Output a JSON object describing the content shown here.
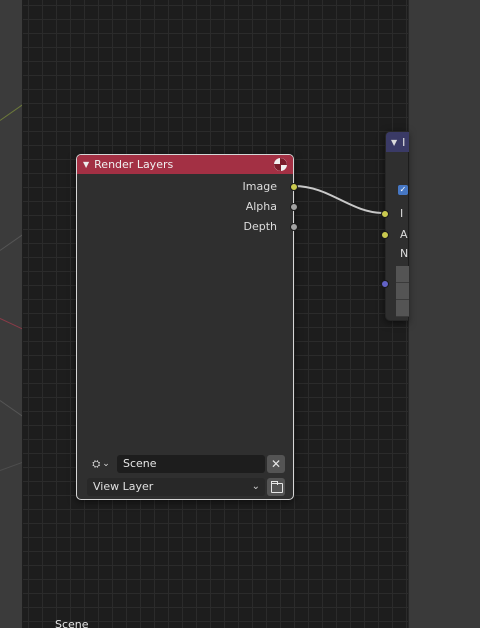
{
  "node_render_layers": {
    "title": "Render Layers",
    "outputs": [
      {
        "label": "Image",
        "socket_color": "#c9c94f"
      },
      {
        "label": "Alpha",
        "socket_color": "#a1a1a1"
      },
      {
        "label": "Depth",
        "socket_color": "#a1a1a1"
      }
    ],
    "scene_field": "Scene",
    "layer_select": "View Layer",
    "header_color": "#a33044"
  },
  "node_partial": {
    "title": "I",
    "inputs": [
      {
        "label": "I",
        "socket_color": "#c9c94f"
      },
      {
        "label": "A",
        "socket_color": "#c9c94f"
      },
      {
        "label": "N"
      },
      {
        "label": "",
        "socket_color": "#6363c7"
      }
    ],
    "header_color": "#3a3a66"
  },
  "footer": {
    "scene_label": "Scene"
  },
  "icons": {
    "collapse": "▼",
    "close": "✕",
    "chevron": "⌄"
  }
}
